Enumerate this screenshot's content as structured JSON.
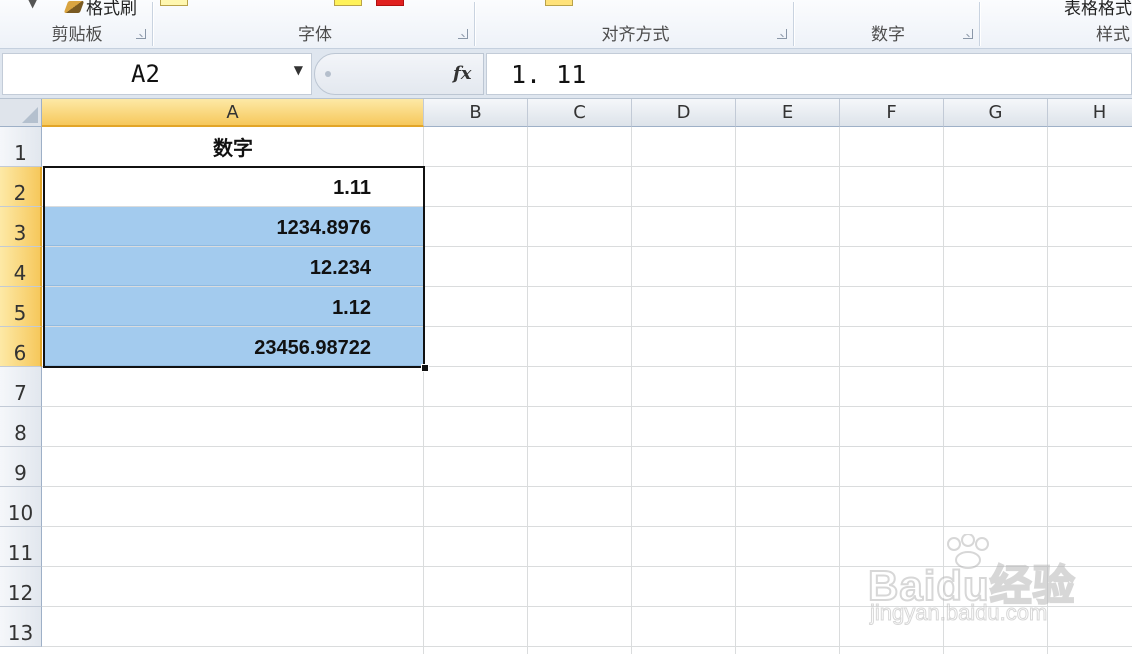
{
  "ribbon": {
    "format_painter_label": "格式刷",
    "table_format_label": "表格格式",
    "groups": [
      {
        "label": "剪贴板"
      },
      {
        "label": "字体"
      },
      {
        "label": "对齐方式"
      },
      {
        "label": "数字"
      },
      {
        "label": "样式"
      }
    ]
  },
  "formula_bar": {
    "name_box": "A2",
    "fx_label": "fx",
    "formula": "1. 11"
  },
  "sheet": {
    "columns": [
      "A",
      "B",
      "C",
      "D",
      "E",
      "F",
      "G",
      "H"
    ],
    "rows": [
      "1",
      "2",
      "3",
      "4",
      "5",
      "6",
      "7",
      "8",
      "9",
      "10",
      "11",
      "12",
      "13"
    ],
    "selected_column": "A",
    "selected_rows": [
      "2",
      "3",
      "4",
      "5",
      "6"
    ],
    "cells": {
      "A1": "数字",
      "A2": "1.11",
      "A3": "1234.8976",
      "A4": "12.234",
      "A5": "1.12",
      "A6": "23456.98722"
    },
    "highlight_color": "#a3cbee",
    "selection_header_color": "#f6c85c"
  },
  "watermark": {
    "logo": "Baidu经验",
    "url": "jingyan.baidu.com"
  }
}
